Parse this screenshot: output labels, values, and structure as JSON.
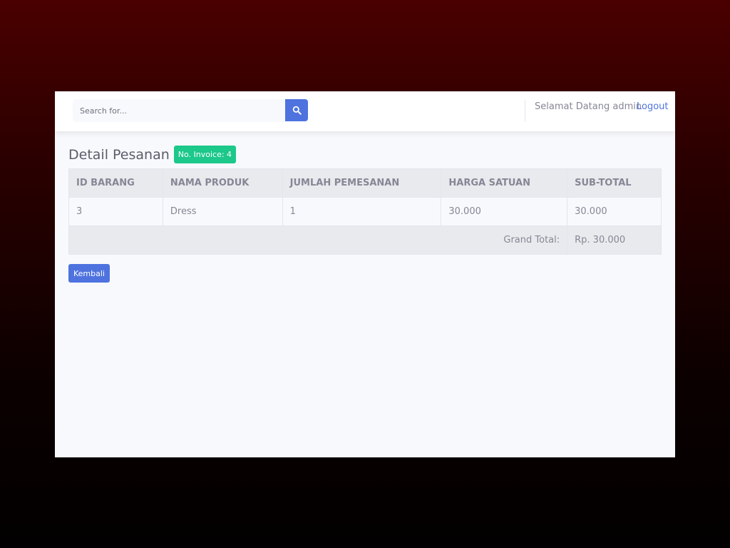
{
  "colors": {
    "primary": "#4e73df",
    "success": "#1cc88a",
    "text": "#858796"
  },
  "search": {
    "placeholder": "Search for...",
    "icon": "search-icon"
  },
  "topbar": {
    "welcome": "Selamat Datang admin",
    "logout": "Logout"
  },
  "page": {
    "title": "Detail Pesanan",
    "invoice_badge": "No. Invoice: 4"
  },
  "table": {
    "headers": [
      "ID BARANG",
      "NAMA PRODUK",
      "JUMLAH PEMESANAN",
      "HARGA SATUAN",
      "SUB-TOTAL"
    ],
    "rows": [
      [
        "3",
        "Dress",
        "1",
        "30.000",
        "30.000"
      ]
    ],
    "grand_total_label": "Grand Total:",
    "grand_total_value": "Rp. 30.000"
  },
  "actions": {
    "back": "Kembali"
  }
}
